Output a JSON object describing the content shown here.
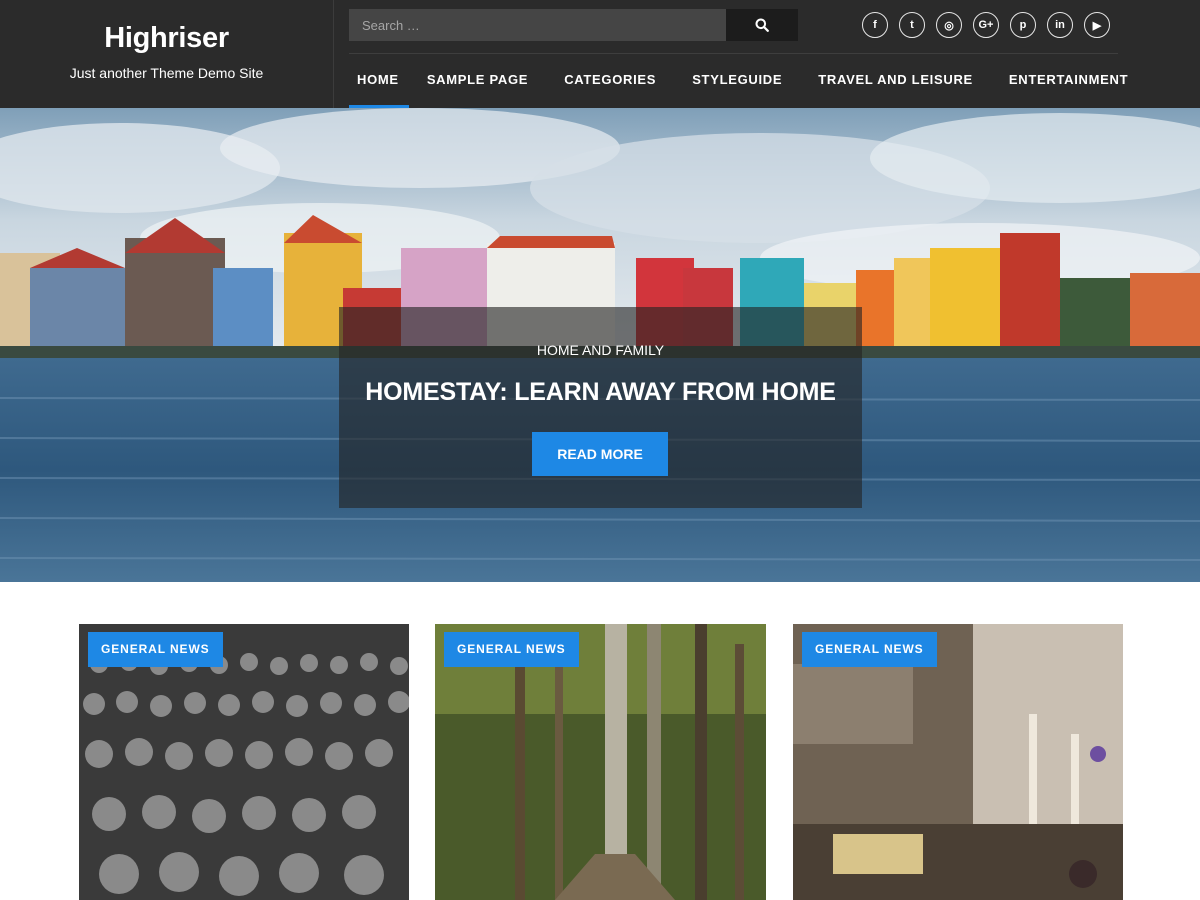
{
  "site": {
    "title": "Highriser",
    "tagline": "Just another Theme Demo Site"
  },
  "search": {
    "placeholder": "Search …",
    "button_icon": "search-icon"
  },
  "social": [
    {
      "name": "facebook-icon",
      "glyph": "f"
    },
    {
      "name": "twitter-icon",
      "glyph": "t"
    },
    {
      "name": "instagram-icon",
      "glyph": "◎"
    },
    {
      "name": "google-plus-icon",
      "glyph": "G+"
    },
    {
      "name": "pinterest-icon",
      "glyph": "p"
    },
    {
      "name": "linkedin-icon",
      "glyph": "in"
    },
    {
      "name": "youtube-icon",
      "glyph": "▶"
    }
  ],
  "nav": {
    "items": [
      {
        "label": "HOME",
        "active": true
      },
      {
        "label": "SAMPLE PAGE",
        "active": false
      },
      {
        "label": "CATEGORIES",
        "active": false
      },
      {
        "label": "STYLEGUIDE",
        "active": false
      },
      {
        "label": "TRAVEL AND LEISURE",
        "active": false
      },
      {
        "label": "ENTERTAINMENT",
        "active": false
      }
    ]
  },
  "hero": {
    "category": "HOME AND FAMILY",
    "title": "HOMESTAY: LEARN AWAY FROM HOME",
    "button": "READ MORE"
  },
  "cards": [
    {
      "category": "GENERAL NEWS"
    },
    {
      "category": "GENERAL NEWS"
    },
    {
      "category": "GENERAL NEWS"
    }
  ],
  "colors": {
    "header_bg": "#2b2b2b",
    "accent": "#1e88e5",
    "search_bg": "#454545",
    "search_button_bg": "#1c1c1c"
  }
}
